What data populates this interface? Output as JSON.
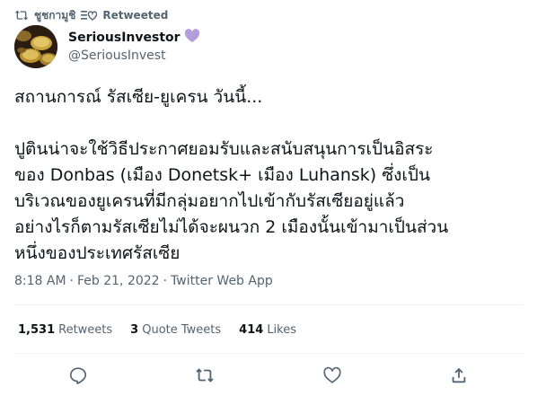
{
  "retweet": {
    "retweeter": "ชูชกามูชิ",
    "label": "Retweeted",
    "retweet_icon": "retweet-icon",
    "badge_icon": "list-heart-icon"
  },
  "author": {
    "display_name": "SeriousInvestor",
    "handle": "@SeriousInvest",
    "badge_icon": "purple-heart-icon",
    "badge_color": "#b39ddb"
  },
  "tweet": {
    "paragraphs": [
      "สถานการณ์ รัสเซีย-ยูเครน วันนี้...",
      "ปูตินน่าจะใช้วิธีประกาศยอมรับและสนับสนุนการเป็นอิสระ\nของ Donbas (เมือง Donetsk+ เมือง Luhansk) ซึ่งเป็น\nบริเวณของยูเครนที่มีกลุ่มอยากไปเข้ากับรัสเซียอยู่แล้ว\nอย่างไรก็ตามรัสเซียไม่ได้จะผนวก 2 เมืองนั้นเข้ามาเป็นส่วน\nหนึ่งของประเทศรัสเซีย"
    ]
  },
  "meta": {
    "time": "8:18 AM",
    "separator": "·",
    "date": "Feb 21, 2022",
    "source": "Twitter Web App"
  },
  "stats": {
    "retweets": {
      "count": "1,531",
      "label": "Retweets"
    },
    "quotes": {
      "count": "3",
      "label": "Quote Tweets"
    },
    "likes": {
      "count": "414",
      "label": "Likes"
    }
  },
  "actions": [
    "reply-icon",
    "retweet-icon",
    "like-icon",
    "share-icon"
  ],
  "colors": {
    "text": "#0f1419",
    "secondary": "#536471",
    "divider": "#eff3f4",
    "accent": "#b39ddb"
  }
}
